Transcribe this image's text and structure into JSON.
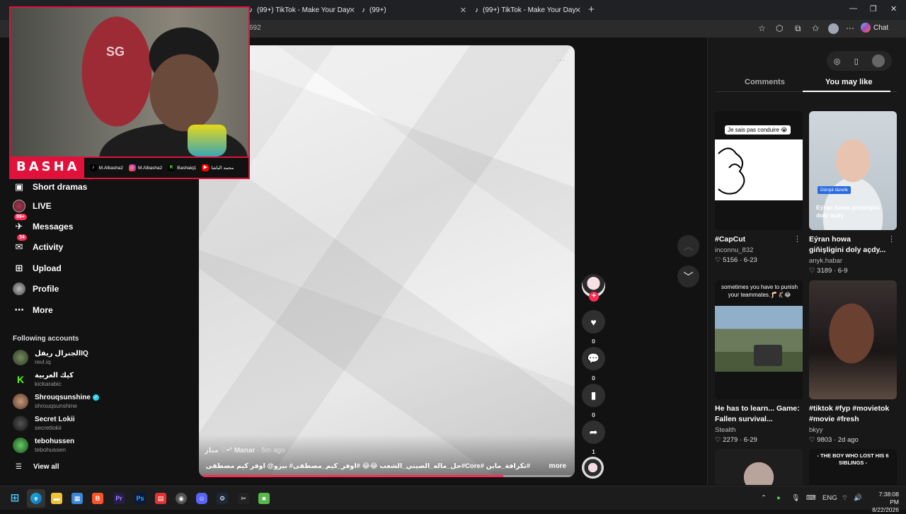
{
  "browser": {
    "tabs": [
      {
        "label": "(99+) TikTok - Make Your Day"
      },
      {
        "label": "(99+)"
      },
      {
        "label": "(99+) TikTok - Make Your Day"
      }
    ],
    "new_tab_glyph": "+",
    "url_fragment": "692",
    "chat_label": "Chat"
  },
  "sidebar": {
    "items": [
      {
        "label": "Short dramas",
        "icon": "short-dramas-icon"
      },
      {
        "label": "LIVE",
        "icon": "live-icon"
      },
      {
        "label": "Messages",
        "icon": "messages-icon",
        "badge": "99+"
      },
      {
        "label": "Activity",
        "icon": "activity-icon",
        "badge": "34"
      },
      {
        "label": "Upload",
        "icon": "upload-icon"
      },
      {
        "label": "Profile",
        "icon": "profile-icon"
      },
      {
        "label": "More",
        "icon": "more-icon"
      }
    ],
    "following_heading": "Following accounts",
    "accounts": [
      {
        "name": "الجنرال ريفلIQ",
        "handle": "revl.iq",
        "color": "#4a5a3a"
      },
      {
        "name": "كيك العربية",
        "handle": "kickarabic",
        "color": "#53fc18"
      },
      {
        "name": "Shrouqsunshine",
        "handle": "shrouqsunshine",
        "verified": true,
        "color": "#8a6a55"
      },
      {
        "name": "Secret Lokii",
        "handle": "secretlokii",
        "color": "#2b2b2b"
      },
      {
        "name": "tebohussen",
        "handle": "tebohussen",
        "color": "#3c8a3c"
      }
    ],
    "view_all": "View all"
  },
  "video": {
    "author": "منار ♡•° Manar",
    "time": "· 5m ago",
    "caption": "#تكرافة_ماين #Core#حل_ماله_الصيني_الشعب 😂😂 #اوفر_كيم_مصطفى# بيرو@ اوفر كيم مصطفى Mustafa GO ...",
    "more": "more",
    "progress": 0.81,
    "actions": [
      {
        "icon": "heart-icon",
        "count": "0"
      },
      {
        "icon": "comment-icon",
        "count": "0"
      },
      {
        "icon": "bookmark-icon",
        "count": "0"
      },
      {
        "icon": "share-icon",
        "count": "1"
      }
    ]
  },
  "right_panel": {
    "tabs": [
      "Comments",
      "You may like"
    ],
    "active_tab": "You may like",
    "cards": [
      {
        "overlay": "Je sais pas conduire 😭",
        "title": "#CapCut",
        "author": "inconnu_832",
        "likes": "5156",
        "date": "6-23"
      },
      {
        "overlay": "Dünýä täzelik",
        "overlay2": "Eýran howa giňişligini doly açdy",
        "title": "Eýran howa giňişligini doly açdy...",
        "author": "anyk.habar",
        "likes": "3189",
        "date": "6-9"
      },
      {
        "overlay": "sometimes you have to punish your teammates.🦵🏻🤾🏻😂",
        "title": "He has to learn... Game: Fallen survival...",
        "author": "Stealth",
        "likes": "2279",
        "date": "6-29"
      },
      {
        "overlay": "",
        "title": "#tiktok #fyp #movietok #movie #fresh",
        "author": "bkyy",
        "likes": "9803",
        "date": "2d ago"
      },
      {
        "overlay": "",
        "title": "",
        "author": "",
        "likes": "",
        "date": ""
      },
      {
        "overlay": "- THE BOY WHO LOST HIS 6 SIBLINGS -",
        "title": "",
        "author": "",
        "likes": "",
        "date": ""
      }
    ]
  },
  "webcam": {
    "name": "BASHA",
    "logo": "SG",
    "socials": [
      {
        "icon": "tiktok-icon",
        "label": "M.Albasha2"
      },
      {
        "icon": "instagram-icon",
        "label": "M.Albasha2"
      },
      {
        "icon": "kick-icon",
        "label": "Bashaiq1"
      },
      {
        "icon": "youtube-icon",
        "label": "محمد الباشا"
      }
    ]
  },
  "taskbar": {
    "lang": "ENG",
    "time": "7:38:08 PM",
    "date": "8/22/2026"
  },
  "colors": {
    "accent": "#fe2c55",
    "stream_red": "#e0113a",
    "background": "#121212"
  }
}
